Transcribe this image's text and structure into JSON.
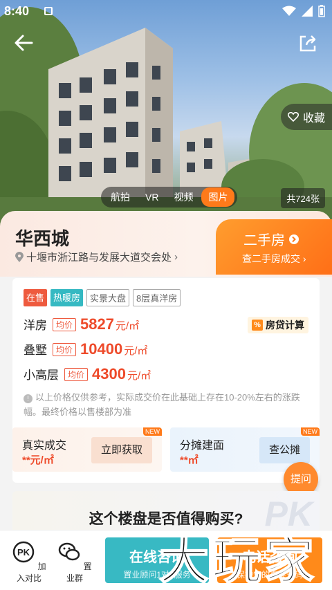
{
  "status_bar": {
    "time": "8:40"
  },
  "hero": {
    "favorite_label": "收藏",
    "media_tabs": [
      {
        "label": "航拍",
        "active": false
      },
      {
        "label": "VR",
        "active": false
      },
      {
        "label": "视频",
        "active": false
      },
      {
        "label": "图片",
        "active": true
      }
    ],
    "photo_count": "共724张"
  },
  "project": {
    "name": "华西城",
    "address": "十堰市浙江路与发展大道交会处"
  },
  "resale": {
    "title": "二手房",
    "subtitle": "查二手房成交"
  },
  "tags": [
    {
      "label": "在售",
      "style": "red"
    },
    {
      "label": "热暖房",
      "style": "teal"
    },
    {
      "label": "实景大盘",
      "style": "outline"
    },
    {
      "label": "8层真洋房",
      "style": "outline"
    }
  ],
  "prices": [
    {
      "type": "洋房",
      "avg_label": "均价",
      "value": "5827",
      "unit": "元/㎡"
    },
    {
      "type": "叠墅",
      "avg_label": "均价",
      "value": "10400",
      "unit": "元/㎡"
    },
    {
      "type": "小高层",
      "avg_label": "均价",
      "value": "4300",
      "unit": "元/㎡"
    }
  ],
  "mortgage_label": "房贷计算",
  "disclaimer": "以上价格仅供参考，实际成交价在此基础上存在10-20%左右的涨跌幅。最终价格以售楼部为准",
  "info_boxes": {
    "left": {
      "label": "真实成交",
      "value": "**元/㎡",
      "action": "立即获取",
      "badge": "NEW"
    },
    "right": {
      "label": "分摊建面",
      "value": "**㎡",
      "action": "查公摊",
      "badge": "NEW"
    }
  },
  "ask_label": "提问",
  "worth": {
    "question": "这个楼盘是否值得购买?",
    "badge": "PK"
  },
  "bottom_bar": {
    "compare_label": "加入对比",
    "group_label": "置业群",
    "consult_title": "在线咨询",
    "consult_sub": "置业顾问1对1服务",
    "phone_title": "电话咨询",
    "phone_sub": "保护您的真实号码"
  },
  "watermark": "大玩家",
  "colors": {
    "accent": "#ff7a1a",
    "teal": "#38b9c3",
    "price_red": "#ee4a2a"
  }
}
